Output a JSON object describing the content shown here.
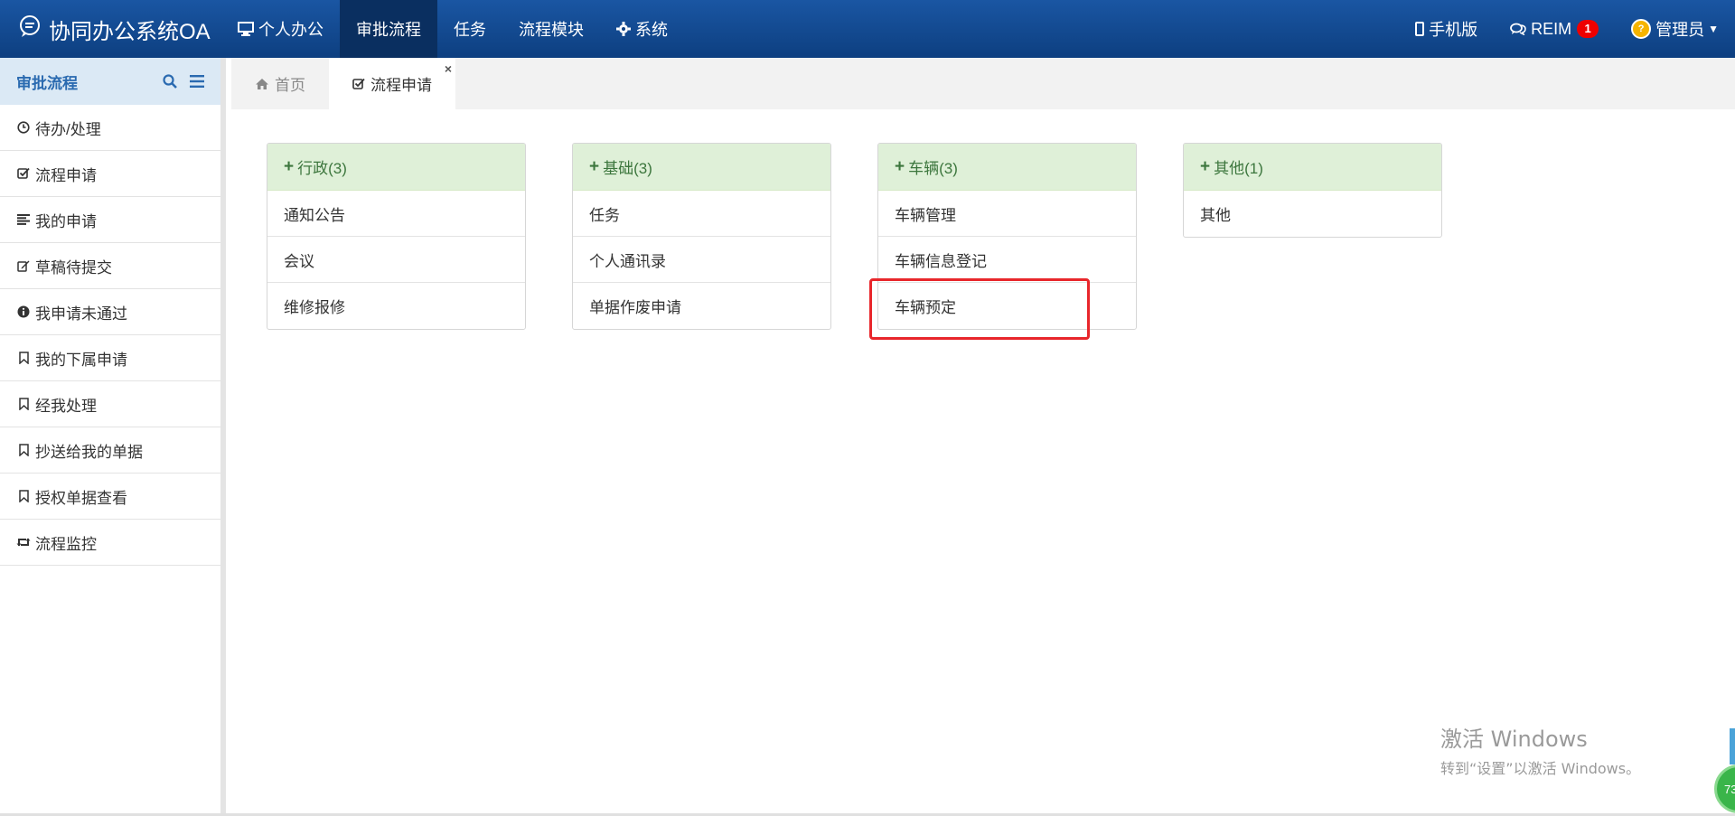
{
  "app": {
    "title": "协同办公系统OA"
  },
  "topnav": {
    "items": [
      {
        "label": "个人办公",
        "icon": "monitor-icon"
      },
      {
        "label": "审批流程",
        "active": true
      },
      {
        "label": "任务"
      },
      {
        "label": "流程模块"
      },
      {
        "label": "系统",
        "icon": "gear-icon"
      }
    ],
    "mobile_label": "手机版",
    "chat_label": "REIM",
    "chat_badge": "1",
    "user_label": "管理员"
  },
  "sidebar": {
    "title": "审批流程",
    "items": [
      {
        "label": "待办/处理",
        "icon": "clock-icon"
      },
      {
        "label": "流程申请",
        "icon": "check-square-icon"
      },
      {
        "label": "我的申请",
        "icon": "list-icon"
      },
      {
        "label": "草稿待提交",
        "icon": "edit-icon"
      },
      {
        "label": "我申请未通过",
        "icon": "info-icon"
      },
      {
        "label": "我的下属申请",
        "icon": "bookmark-icon"
      },
      {
        "label": "经我处理",
        "icon": "bookmark-icon"
      },
      {
        "label": "抄送给我的单据",
        "icon": "bookmark-icon"
      },
      {
        "label": "授权单据查看",
        "icon": "bookmark-icon"
      },
      {
        "label": "流程监控",
        "icon": "retweet-icon"
      }
    ]
  },
  "tabs": [
    {
      "label": "首页",
      "icon": "home-icon"
    },
    {
      "label": "流程申请",
      "icon": "check-square-icon",
      "active": true,
      "close": "×"
    }
  ],
  "panels": [
    {
      "heading": "行政(3)",
      "rows": [
        "通知公告",
        "会议",
        "维修报修"
      ]
    },
    {
      "heading": "基础(3)",
      "rows": [
        "任务",
        "个人通讯录",
        "单据作废申请"
      ]
    },
    {
      "heading": "车辆(3)",
      "rows": [
        "车辆管理",
        "车辆信息登记",
        "车辆预定"
      ]
    },
    {
      "heading": "其他(1)",
      "rows": [
        "其他"
      ]
    }
  ],
  "highlight": {
    "target": "车辆预定",
    "color": "#e8262b"
  },
  "watermark": {
    "line1": "激活 Windows",
    "line2": "转到“设置”以激活 Windows。"
  },
  "corner_widget": {
    "text": "73"
  },
  "colors": {
    "navbar": "#0d3f80",
    "navbar_active": "#0a2f60",
    "sidebar_header": "#dbe9f5",
    "panel_heading": "#dff0d8",
    "panel_heading_text": "#3c763d"
  }
}
